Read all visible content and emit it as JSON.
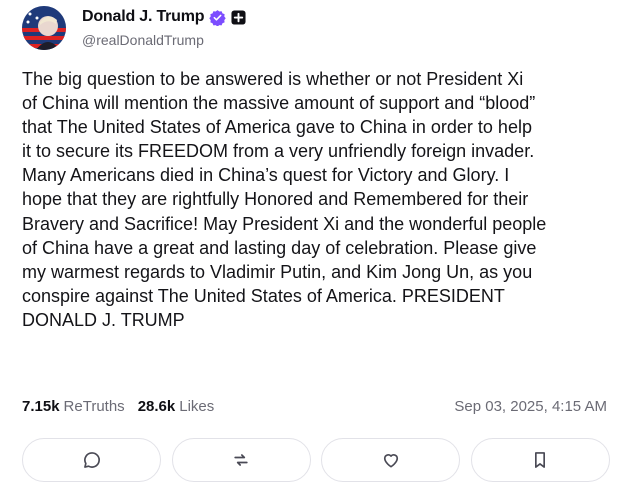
{
  "author": {
    "display_name": "Donald J. Trump",
    "handle": "@realDonaldTrump",
    "verified_color": "#7c4dff"
  },
  "post": {
    "text": "The big question to be  answered is whether or not President Xi\nof China will mention the massive amount of  support and “blood”\nthat The United States of America gave to China in order to help\nit to secure its FREEDOM from a very unfriendly foreign invader.\nMany Americans died in China’s quest for Victory and Glory. I\nhope that they are rightfully Honored and Remembered for their\nBravery and Sacrifice! May President Xi and the wonderful people\nof China have a great and lasting day of celebration. Please give\nmy warmest regards to Vladimir Putin, and Kim Jong Un, as you\nconspire against The United States of America. PRESIDENT\nDONALD J. TRUMP"
  },
  "stats": {
    "retruths_count": "7.15k",
    "retruths_label": "ReTruths",
    "likes_count": "28.6k",
    "likes_label": "Likes",
    "timestamp": "Sep 03, 2025, 4:15 AM"
  },
  "actions": [
    {
      "icon": "comment-icon"
    },
    {
      "icon": "retruth-icon"
    },
    {
      "icon": "heart-icon"
    },
    {
      "icon": "bookmark-icon"
    }
  ]
}
